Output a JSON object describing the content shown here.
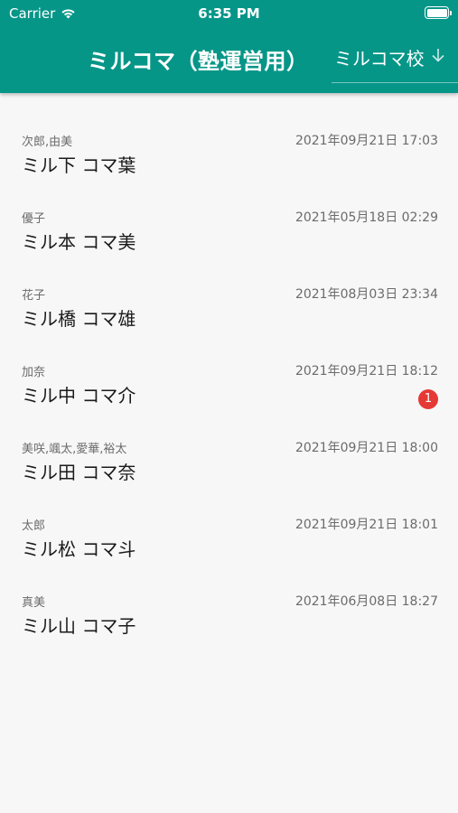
{
  "status_bar": {
    "carrier": "Carrier",
    "time": "6:35 PM",
    "wifi_icon": "wifi-icon",
    "battery_icon": "battery-icon"
  },
  "header": {
    "title": "ミルコマ（塾運営用）",
    "school_select_value": "ミルコマ校",
    "dropdown_icon": "arrow-down-icon",
    "background_color": "#069688"
  },
  "chats": [
    {
      "members": "次郎,由美",
      "name": "ミル下 コマ葉",
      "timestamp": "2021年09月21日 17:03",
      "unread": ""
    },
    {
      "members": "優子",
      "name": "ミル本 コマ美",
      "timestamp": "2021年05月18日 02:29",
      "unread": ""
    },
    {
      "members": "花子",
      "name": "ミル橋 コマ雄",
      "timestamp": "2021年08月03日 23:34",
      "unread": ""
    },
    {
      "members": "加奈",
      "name": "ミル中 コマ介",
      "timestamp": "2021年09月21日 18:12",
      "unread": "1"
    },
    {
      "members": "美咲,颯太,愛華,裕太",
      "name": "ミル田 コマ奈",
      "timestamp": "2021年09月21日 18:00",
      "unread": ""
    },
    {
      "members": "太郎",
      "name": "ミル松 コマ斗",
      "timestamp": "2021年09月21日 18:01",
      "unread": ""
    },
    {
      "members": "真美",
      "name": "ミル山 コマ子",
      "timestamp": "2021年06月08日 18:27",
      "unread": ""
    }
  ],
  "colors": {
    "accent": "#069688",
    "badge": "#e53935"
  }
}
